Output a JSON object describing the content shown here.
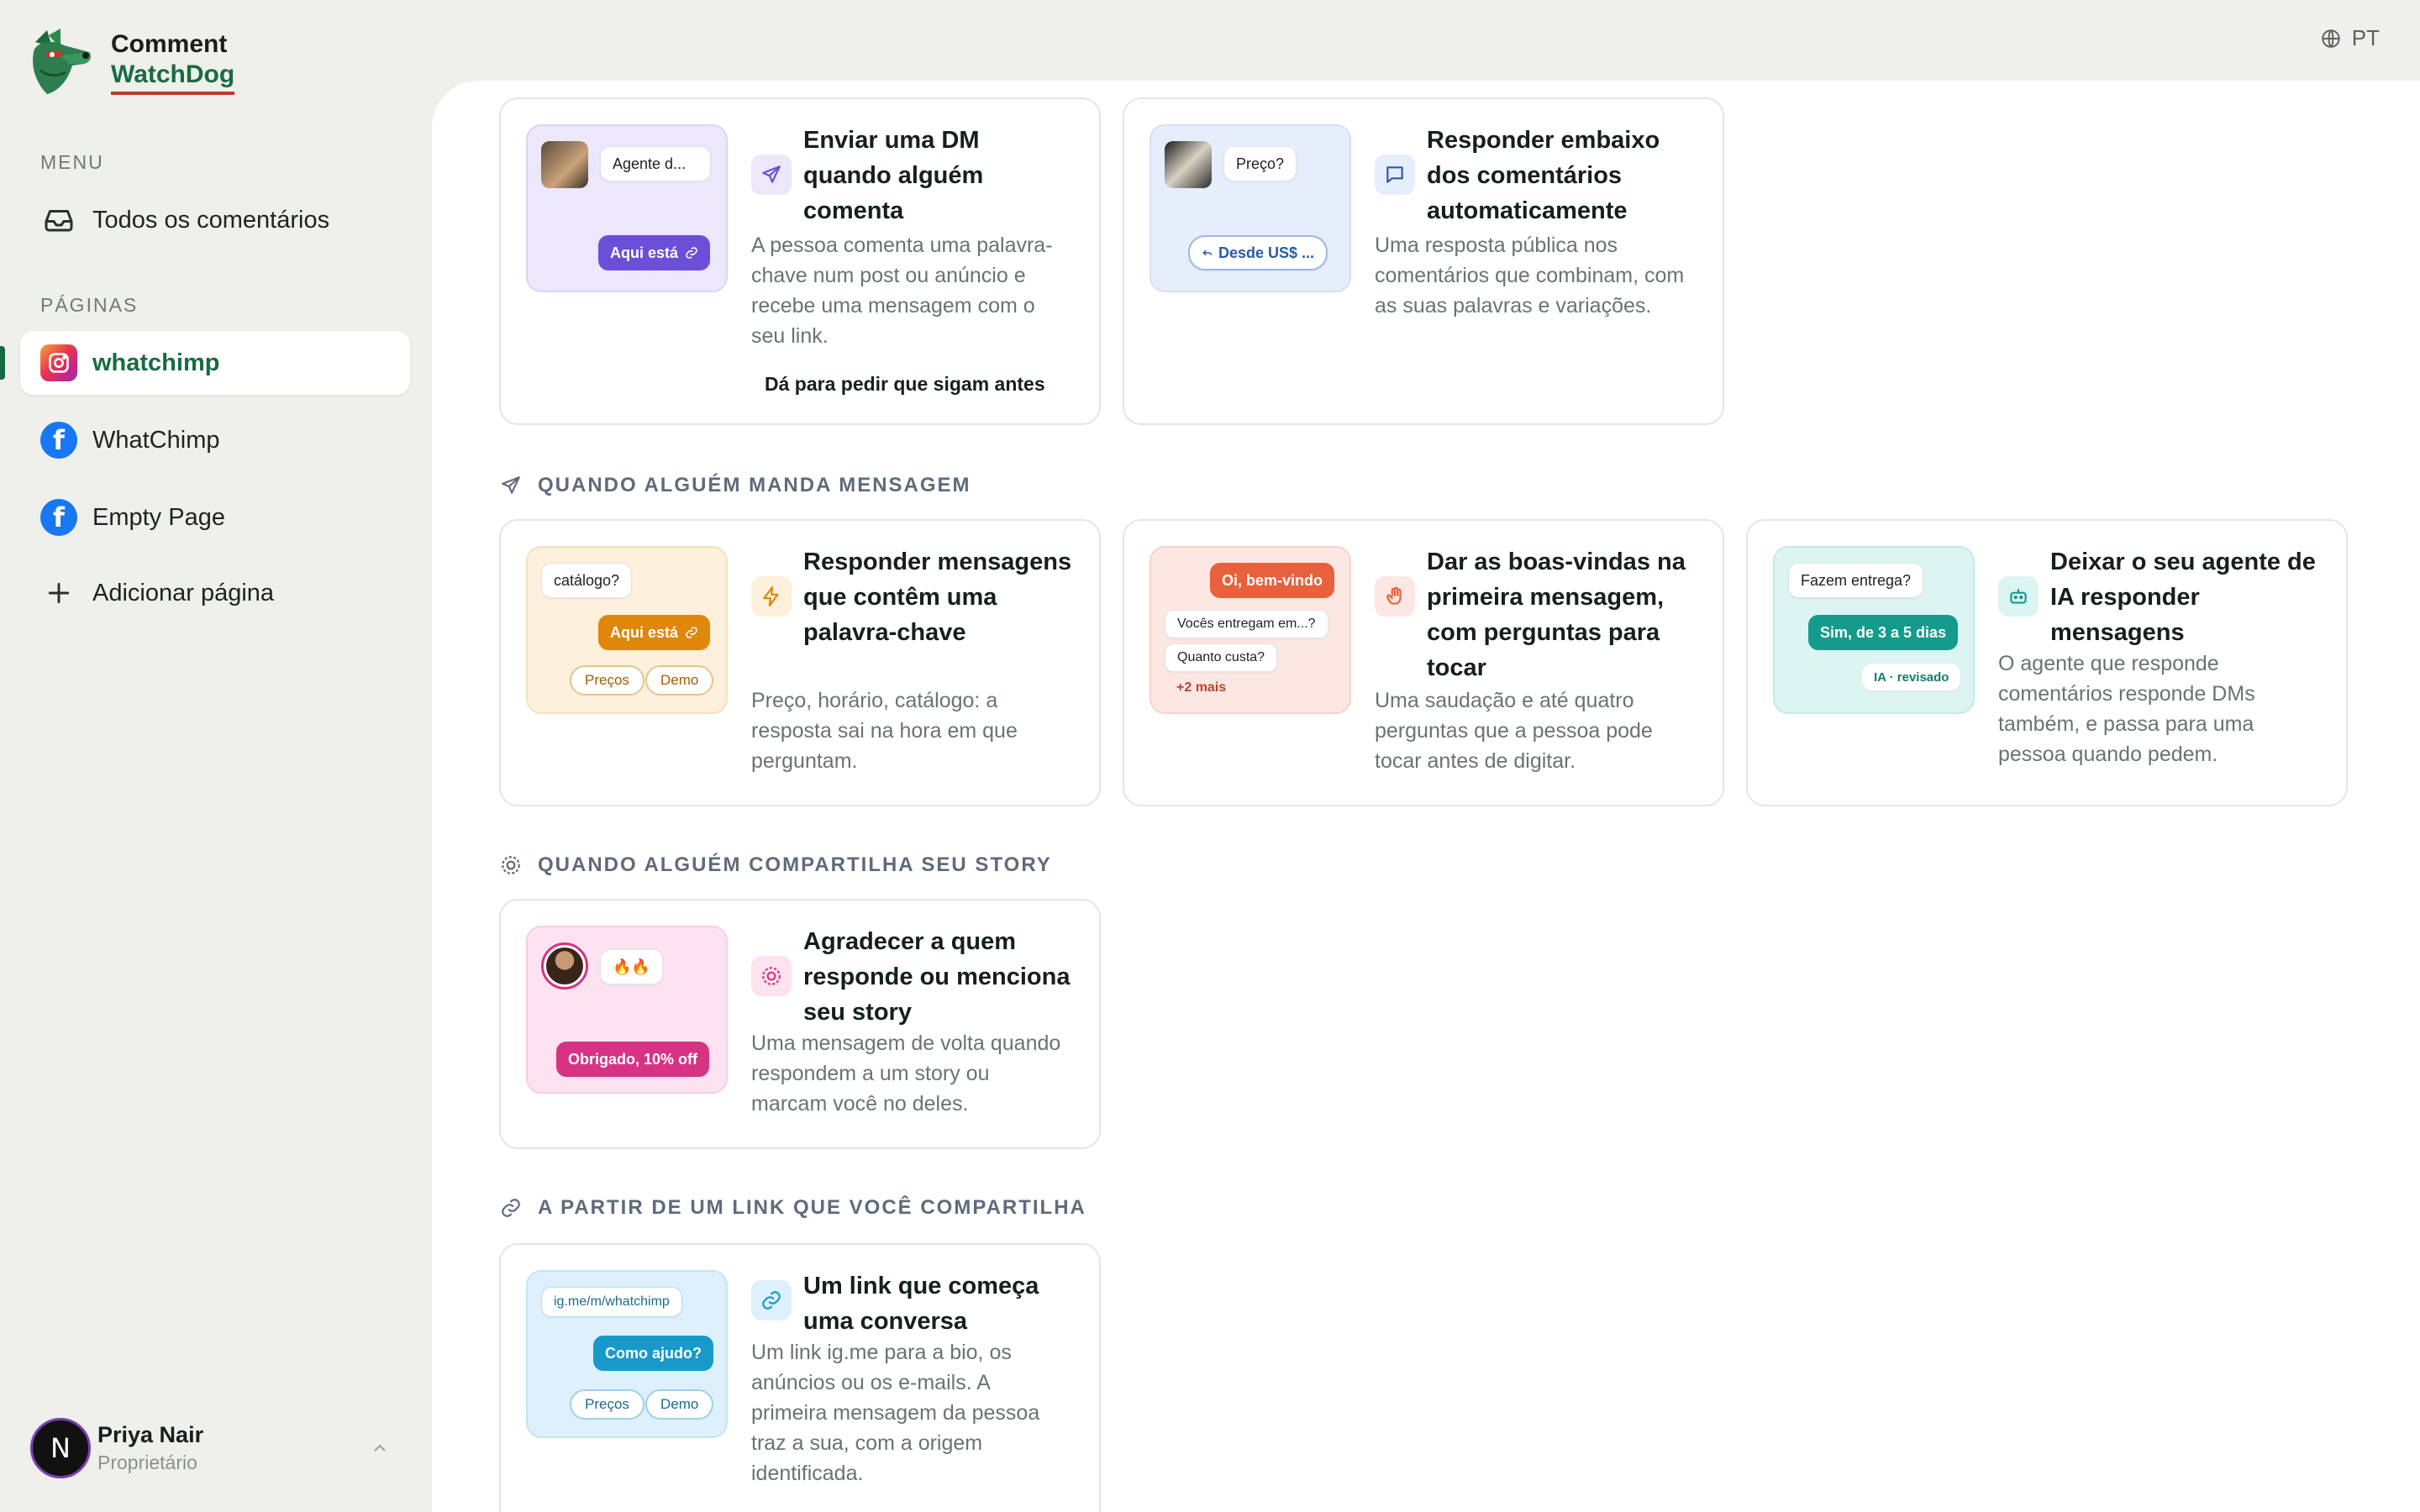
{
  "app": {
    "logo_line1": "Comment",
    "logo_line2": "WatchDog",
    "language": "PT"
  },
  "sidebar": {
    "menu_label": "MENU",
    "all_comments": "Todos os comentários",
    "pages_label": "PÁGINAS",
    "pages": [
      {
        "label": "whatchimp",
        "icon": "instagram-icon",
        "active": true
      },
      {
        "label": "WhatChimp",
        "icon": "facebook-icon",
        "active": false
      },
      {
        "label": "Empty Page",
        "icon": "facebook-icon",
        "active": false
      }
    ],
    "add_page": "Adicionar página",
    "user": {
      "initial": "N",
      "name": "Priya Nair",
      "role": "Proprietário"
    }
  },
  "sections": {
    "message": "QUANDO ALGUÉM MANDA MENSAGEM",
    "story": "QUANDO ALGUÉM COMPARTILHA SEU STORY",
    "link": "A PARTIR DE UM LINK QUE VOCÊ COMPARTILHA"
  },
  "cards": {
    "dm": {
      "title": "Enviar uma DM quando alguém comenta",
      "desc": "A pessoa comenta uma palavra-chave num post ou anúncio e recebe uma mensagem com o seu link.",
      "note": "Dá para pedir que sigam antes",
      "chip1": "Agente d...",
      "chip2": "Aqui está"
    },
    "reply": {
      "title": "Responder embaixo dos comentários automaticamente",
      "desc": "Uma resposta pública nos comentários que combinam, com as suas palavras e variações.",
      "chip1": "Preço?",
      "chip2": "Desde US$ ..."
    },
    "keyword": {
      "title": "Responder mensagens que contêm uma palavra-chave",
      "desc": "Preço, horário, catálogo: a resposta sai na hora em que perguntam.",
      "chip1": "catálogo?",
      "chip2": "Aqui está",
      "pill1": "Preços",
      "pill2": "Demo"
    },
    "welcome": {
      "title": "Dar as boas-vindas na primeira mensagem, com perguntas para tocar",
      "desc": "Uma saudação e até quatro perguntas que a pessoa pode tocar antes de digitar.",
      "chip1": "Oi, bem-vindo",
      "q1": "Vocês entregam em...?",
      "q2": "Quanto custa?",
      "more": "+2 mais"
    },
    "ai": {
      "title": "Deixar o seu agente de IA responder mensagens",
      "desc": "O agente que responde comentários responde DMs também, e passa para uma pessoa quando pedem.",
      "chip1": "Fazem entrega?",
      "chip2": "Sim, de 3 a 5 dias",
      "tag": "IA · revisado"
    },
    "story": {
      "title": "Agradecer a quem responde ou menciona seu story",
      "desc": "Uma mensagem de volta quando respondem a um story ou marcam você no deles.",
      "chip1": "🔥🔥",
      "chip2": "Obrigado, 10% off"
    },
    "link": {
      "title": "Um link que começa uma conversa",
      "desc": "Um link ig.me para a bio, os anúncios ou os e-mails. A primeira mensagem da pessoa traz a sua, com a origem identificada.",
      "chip1": "ig.me/m/whatchimp",
      "chip2": "Como ajudo?",
      "pill1": "Preços",
      "pill2": "Demo"
    }
  },
  "colors": {
    "brand_green": "#176b43",
    "purple": "#6b4fd8",
    "orange": "#e0860a",
    "coral": "#e8603c",
    "teal": "#149b8c",
    "pink": "#d63384",
    "sky": "#1799c9"
  }
}
